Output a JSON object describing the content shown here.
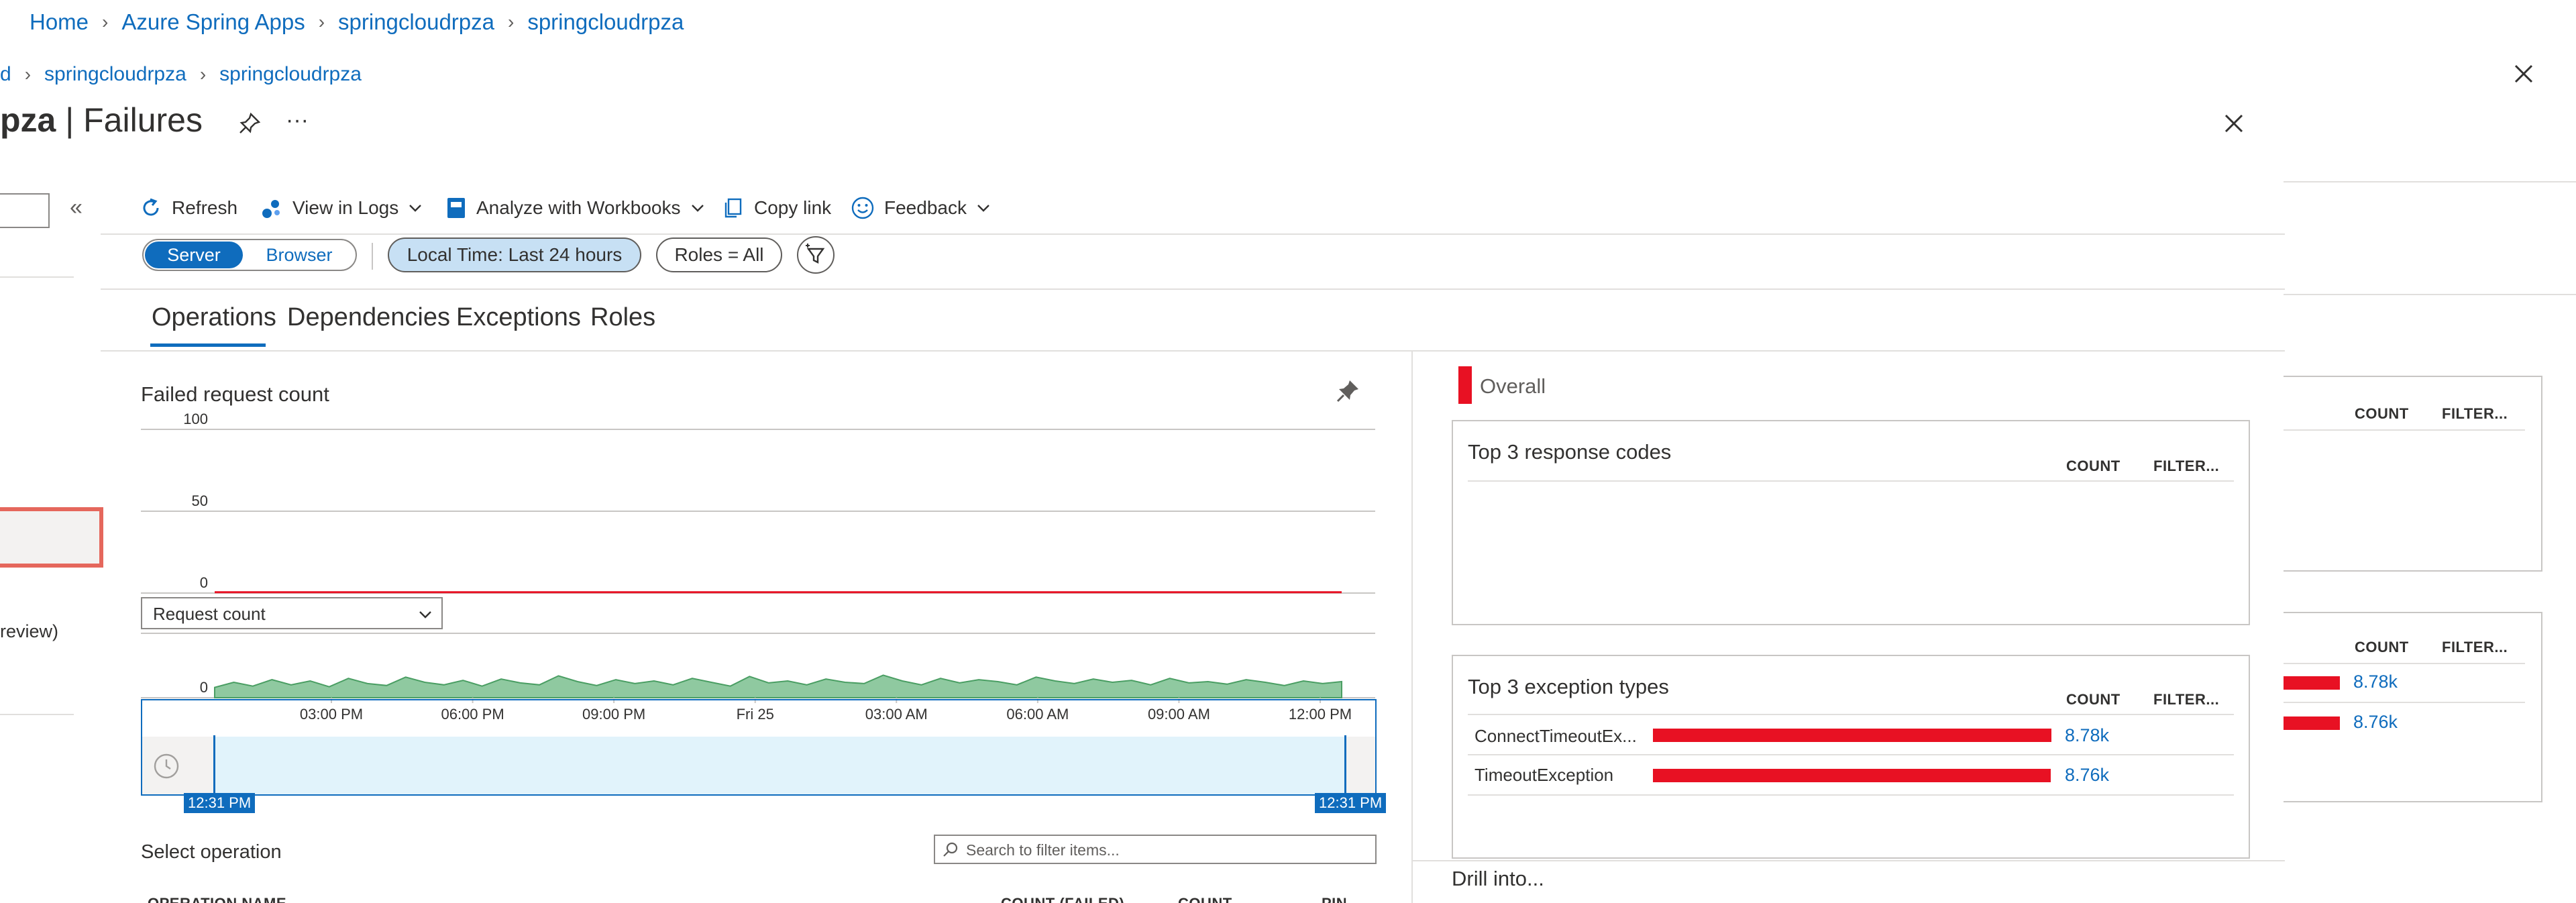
{
  "breadcrumb_top": {
    "items": [
      "Home",
      "Azure Spring Apps",
      "springcloudrpza",
      "springcloudrpza"
    ]
  },
  "breadcrumb_second": {
    "items": [
      "d",
      "springcloudrpza",
      "springcloudrpza"
    ]
  },
  "blade": {
    "title_bold": "pza",
    "title_rest": " | Failures",
    "more": "···"
  },
  "left": {
    "preview_text": "review)",
    "collapse": "«"
  },
  "toolbar": {
    "refresh": "Refresh",
    "view_in_logs": "View in Logs",
    "analyze": "Analyze with Workbooks",
    "copy_link": "Copy link",
    "feedback": "Feedback"
  },
  "filters": {
    "server": "Server",
    "browser": "Browser",
    "time": "Local Time: Last 24 hours",
    "roles": "Roles = All"
  },
  "tabs": [
    "Operations",
    "Dependencies",
    "Exceptions",
    "Roles"
  ],
  "chart": {
    "title": "Failed request count",
    "dropdown": "Request count",
    "select_label": "Select operation",
    "search_placeholder": "Search to filter items...",
    "brush_start": "12:31 PM",
    "brush_end": "12:31 PM",
    "table_headers": [
      "OPERATION NAME",
      "COUNT (FAILED)",
      "COUNT",
      "PIN"
    ]
  },
  "chart_data": [
    {
      "type": "line",
      "title": "Failed request count",
      "ylim": [
        0,
        100
      ],
      "y_ticks": [
        0,
        50,
        100
      ],
      "series": [
        {
          "values": [
            0.5,
            0.5,
            0.5,
            0.5,
            0.5,
            0.5,
            0.5,
            0.5,
            0.5,
            0.5,
            0.5,
            0.5
          ]
        }
      ],
      "x_ticks": [
        "03:00 PM",
        "06:00 PM",
        "09:00 PM",
        "Fri 25",
        "03:00 AM",
        "06:00 AM",
        "09:00 AM",
        "12:00 PM"
      ],
      "line_color": "#e81123"
    },
    {
      "type": "area",
      "ylim": [
        0,
        500
      ],
      "y_ticks": [
        0,
        500
      ],
      "series": [
        {
          "values": [
            80,
            120,
            90,
            140,
            100,
            130,
            85,
            150,
            110,
            95,
            160,
            120,
            100,
            135,
            90,
            145,
            115,
            100,
            170,
            125,
            95,
            140,
            110,
            130,
            100,
            150,
            120,
            90,
            165,
            115,
            130,
            100,
            145,
            120,
            110,
            175,
            130,
            100,
            150,
            115,
            140,
            125,
            100,
            160,
            130,
            110,
            145,
            120,
            135,
            100,
            150,
            115,
            125,
            105,
            140,
            120,
            95,
            130,
            110,
            125
          ]
        }
      ],
      "x_ticks": [
        "03:00 PM",
        "06:00 PM",
        "09:00 PM",
        "Fri 25",
        "03:00 AM",
        "06:00 AM",
        "09:00 AM",
        "12:00 PM"
      ],
      "grid": true
    }
  ],
  "right": {
    "overall": "Overall",
    "response_codes_title": "Top 3 response codes",
    "exception_types_title": "Top 3 exception types",
    "count_header": "COUNT",
    "filter_header": "FILTER...",
    "exceptions": [
      {
        "name": "ConnectTimeoutEx...",
        "count": "8.78k",
        "fraction": 1.0
      },
      {
        "name": "TimeoutException",
        "count": "8.76k",
        "fraction": 0.998
      }
    ],
    "drill_into": "Drill into..."
  },
  "background_panel": {
    "count_header": "COUNT",
    "filter_header": "FILTER...",
    "counts": [
      "8.78k",
      "8.76k"
    ]
  },
  "colors": {
    "accent": "#0f6cbd",
    "failure_red": "#e81123",
    "area_green": "#8fc9a0",
    "highlight_red": "#e5675c"
  }
}
